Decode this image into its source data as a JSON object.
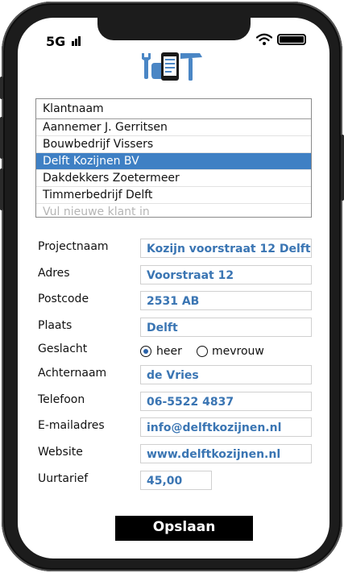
{
  "status": {
    "network": "5G"
  },
  "client_list": {
    "header": "Klantnaam",
    "items": [
      "Aannemer J. Gerritsen",
      "Bouwbedrijf Vissers",
      "Delft Kozijnen BV",
      "Dakdekkers Zoetermeer",
      "Timmerbedrijf Delft"
    ],
    "selected": "Delft Kozijnen BV",
    "new_client_placeholder": "Vul nieuwe klant in"
  },
  "form": {
    "projectnaam": {
      "label": "Projectnaam",
      "value": "Kozijn voorstraat 12 Delft"
    },
    "adres": {
      "label": "Adres",
      "value": "Voorstraat 12"
    },
    "postcode": {
      "label": "Postcode",
      "value": "2531 AB"
    },
    "plaats": {
      "label": "Plaats",
      "value": "Delft"
    },
    "geslacht": {
      "label": "Geslacht",
      "options": [
        "heer",
        "mevrouw"
      ],
      "selected": "heer"
    },
    "achternaam": {
      "label": "Achternaam",
      "value": "de Vries"
    },
    "telefoon": {
      "label": "Telefoon",
      "value": "06-5522 4837"
    },
    "email": {
      "label": "E-mailadres",
      "value": "info@delftkozijnen.nl"
    },
    "website": {
      "label": "Website",
      "value": "www.delftkozijnen.nl"
    },
    "uurtarief": {
      "label": "Uurtarief",
      "value": "45,00"
    }
  },
  "save_label": "Opslaan",
  "colors": {
    "accent": "#3f80c4",
    "field_text": "#3a75b3",
    "logo": "#4a86c5",
    "button": "#000000"
  }
}
